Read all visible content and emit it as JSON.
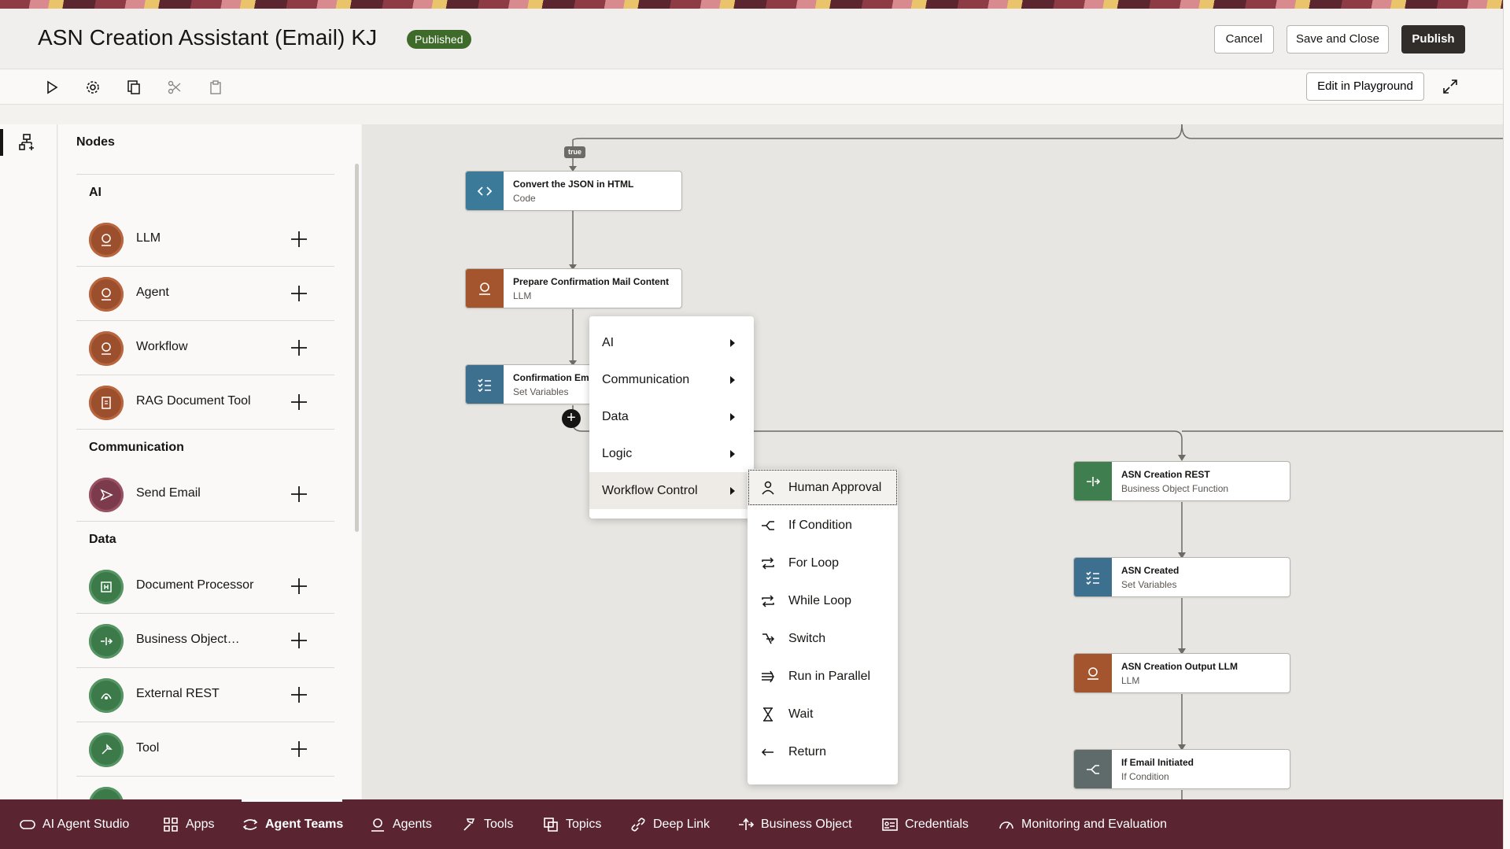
{
  "header": {
    "title": "ASN Creation Assistant (Email) KJ",
    "status": "Published",
    "cancel_label": "Cancel",
    "save_close_label": "Save and Close",
    "publish_label": "Publish"
  },
  "toolbar": {
    "icons": [
      "play-icon",
      "gear-icon",
      "copy-icon",
      "cut-icon",
      "paste-icon"
    ],
    "playground_label": "Edit in Playground"
  },
  "nodes_panel": {
    "title": "Nodes",
    "sections": {
      "ai": "AI",
      "communication": "Communication",
      "data": "Data"
    },
    "items": {
      "llm": "LLM",
      "agent": "Agent",
      "workflow": "Workflow",
      "rag": "RAG Document Tool",
      "send_email": "Send Email",
      "document_processor": "Document Processor",
      "business_object": "Business Object…",
      "external_rest": "External REST",
      "tool": "Tool"
    }
  },
  "canvas": {
    "true_tag": "true",
    "nodes": [
      {
        "title": "Convert the JSON in HTML",
        "type": "Code"
      },
      {
        "title": "Prepare Confirmation Mail Content",
        "type": "LLM"
      },
      {
        "title": "Confirmation Em",
        "type": "Set Variables"
      },
      {
        "title": "ASN Creation REST",
        "type": "Business Object Function"
      },
      {
        "title": "ASN Created",
        "type": "Set Variables"
      },
      {
        "title": "ASN Creation Output LLM",
        "type": "LLM"
      },
      {
        "title": "If Email Initiated",
        "type": "If Condition"
      }
    ]
  },
  "menu": {
    "items": [
      "AI",
      "Communication",
      "Data",
      "Logic",
      "Workflow Control"
    ],
    "active": "Workflow Control"
  },
  "submenu": {
    "items": [
      "Human Approval",
      "If Condition",
      "For Loop",
      "While Loop",
      "Switch",
      "Run in Parallel",
      "Wait",
      "Return"
    ],
    "focused": "Human Approval"
  },
  "bottom_nav": {
    "items": [
      "AI Agent Studio",
      "Apps",
      "Agent Teams",
      "Agents",
      "Tools",
      "Topics",
      "Deep Link",
      "Business Object",
      "Credentials",
      "Monitoring and Evaluation"
    ],
    "active": "Agent Teams"
  },
  "colors": {
    "header_bg": "#f1efed",
    "bottom_bar": "#5a2431",
    "published_badge": "#3f6b2a",
    "publish_button": "#312d2a",
    "llm_node": "#a4552d",
    "vars_node": "#3d6f8f",
    "rest_node": "#3f7e4f"
  }
}
